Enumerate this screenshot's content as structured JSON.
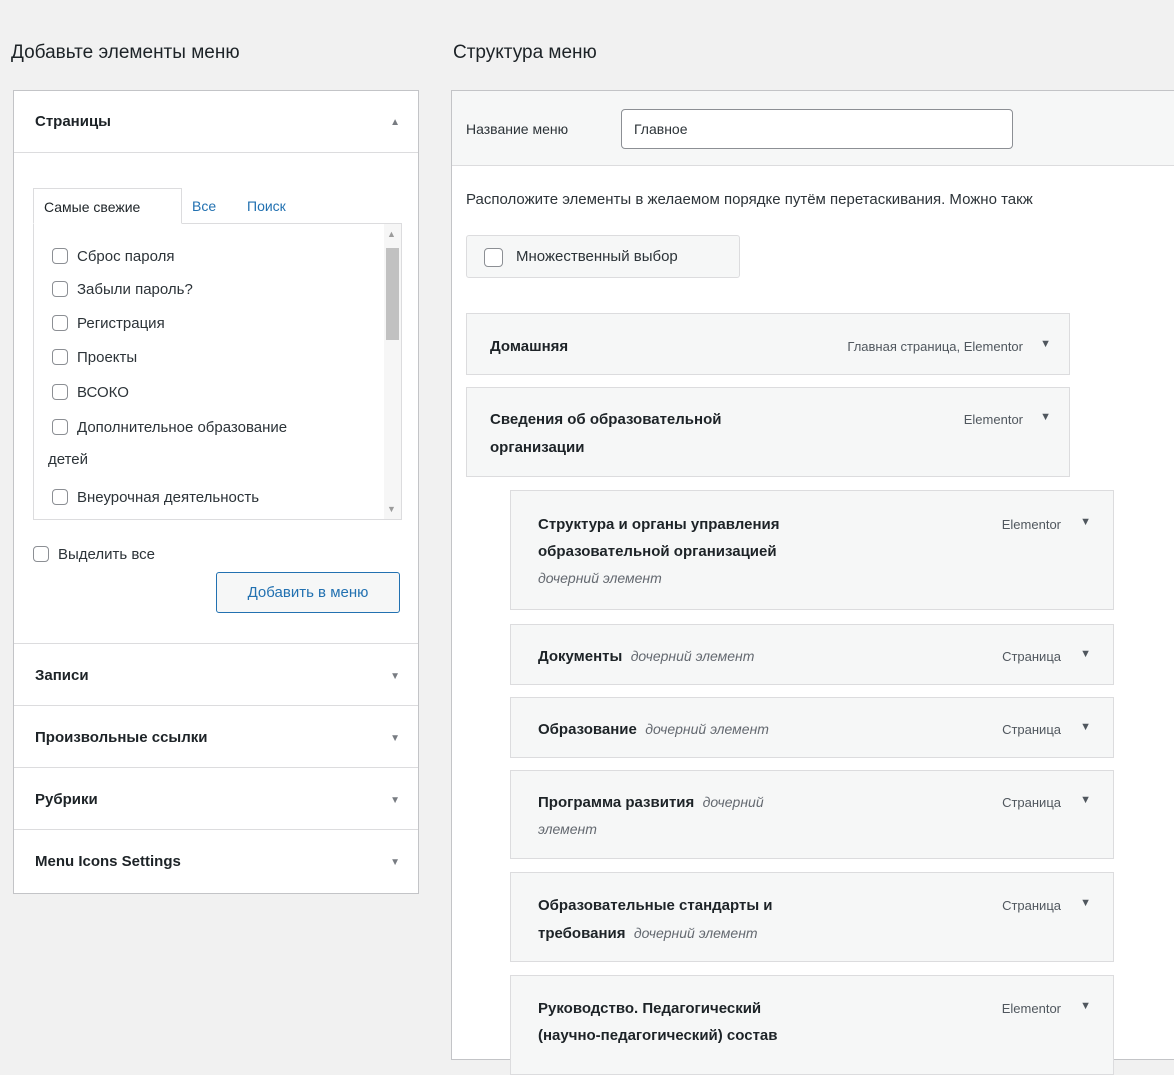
{
  "left": {
    "heading": "Добавьте элементы меню",
    "pages": {
      "title": "Страницы",
      "tabs": [
        "Самые свежие",
        "Все",
        "Поиск"
      ],
      "items": [
        "Сброс пароля",
        "Забыли пароль?",
        "Регистрация",
        "Проекты",
        "ВСОКО",
        "Дополнительное образование",
        "детей",
        "Внеурочная деятельность"
      ],
      "select_all": "Выделить все",
      "add_button": "Добавить в меню"
    },
    "sections": [
      "Записи",
      "Произвольные ссылки",
      "Рубрики",
      "Menu Icons Settings"
    ]
  },
  "right": {
    "heading": "Структура меню",
    "name_label": "Название меню",
    "name_value": "Главное",
    "instructions": "Расположите элементы в желаемом порядке путём перетаскивания. Можно такж",
    "multi_select": "Множественный выбор",
    "items": [
      {
        "title_lines": [
          "Домашняя"
        ],
        "sub": "",
        "type": "Главная страница, Elementor"
      },
      {
        "title_lines": [
          "Сведения об образовательной",
          "организации"
        ],
        "sub": "",
        "type": "Elementor"
      },
      {
        "title_lines": [
          "Структура и органы управления",
          "образовательной организацией"
        ],
        "sub": "дочерний элемент",
        "type": "Elementor"
      },
      {
        "title_lines": [
          "Документы"
        ],
        "sub": "дочерний элемент",
        "type": "Страница"
      },
      {
        "title_lines": [
          "Образование"
        ],
        "sub": "дочерний элемент",
        "type": "Страница"
      },
      {
        "title_lines": [
          "Программа развития"
        ],
        "sub": "дочерний",
        "sub2": "элемент",
        "type": "Страница"
      },
      {
        "title_lines": [
          "Образовательные стандарты и",
          "требования"
        ],
        "sub": "дочерний элемент",
        "type": "Страница"
      },
      {
        "title_lines": [
          "Руководство. Педагогический",
          "(научно-педагогический) состав"
        ],
        "sub": "",
        "type": "Elementor"
      }
    ]
  },
  "colors": {
    "accent": "#2271b1",
    "page_bg": "#f1f1f1",
    "item_bg": "#f6f7f7"
  },
  "icons": {
    "expanded": "triangle-up-icon",
    "collapsed": "triangle-down-icon"
  }
}
